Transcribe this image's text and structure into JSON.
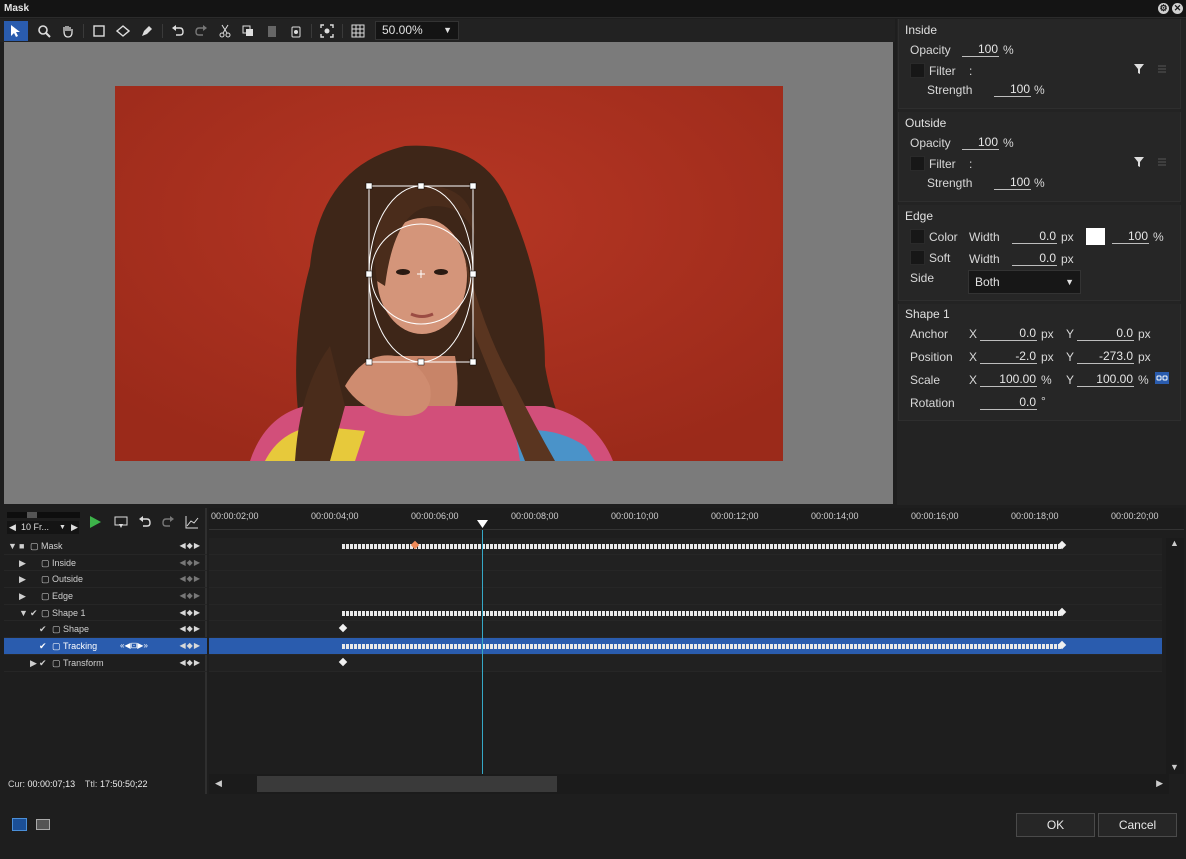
{
  "window": {
    "title": "Mask",
    "settings_icon": "gear-icon",
    "close_icon": "close-icon"
  },
  "toolbar": {
    "tools": [
      "select-arrow-icon",
      "zoom-icon",
      "hand-icon",
      "rectangle-icon",
      "ellipse-icon",
      "pen-icon",
      "undo-icon",
      "redo-icon",
      "cut-icon",
      "copy-icon",
      "paste-icon",
      "delete-icon",
      "fit-icon",
      "grid-icon"
    ],
    "zoom_value": "50.00%"
  },
  "inside": {
    "header": "Inside",
    "opacity_label": "Opacity",
    "opacity_value": "100",
    "opacity_unit": "%",
    "filter_label": "Filter",
    "filter_sep": ":",
    "strength_label": "Strength",
    "strength_value": "100",
    "strength_unit": "%"
  },
  "outside": {
    "header": "Outside",
    "opacity_label": "Opacity",
    "opacity_value": "100",
    "opacity_unit": "%",
    "filter_label": "Filter",
    "filter_sep": ":",
    "strength_label": "Strength",
    "strength_value": "100",
    "strength_unit": "%"
  },
  "edge": {
    "header": "Edge",
    "color_label": "Color",
    "width_label": "Width",
    "color_width_value": "0.0",
    "px": "px",
    "color_swatch": "#ffffff",
    "color_pct_value": "100",
    "pct": "%",
    "soft_label": "Soft",
    "soft_width_value": "0.0",
    "side_label": "Side",
    "side_value": "Both"
  },
  "shape1": {
    "header": "Shape 1",
    "anchor_label": "Anchor",
    "anchor_x": "0.0",
    "anchor_y": "0.0",
    "position_label": "Position",
    "position_x": "-2.0",
    "position_y": "-273.0",
    "scale_label": "Scale",
    "scale_x": "100.00",
    "scale_y": "100.00",
    "rotation_label": "Rotation",
    "rotation_value": "0.0",
    "degree": "°",
    "x": "X",
    "y": "Y",
    "px": "px",
    "pct": "%"
  },
  "timeline": {
    "frames_select": "10 Fr...",
    "ruler": [
      "00:00:02;00",
      "00:00:04;00",
      "00:00:06;00",
      "00:00:08;00",
      "00:00:10;00",
      "00:00:12;00",
      "00:00:14;00",
      "00:00:16;00",
      "00:00:18;00",
      "00:00:20;00"
    ],
    "tracks": [
      "Mask",
      "Inside",
      "Outside",
      "Edge",
      "Shape 1",
      "Shape",
      "Tracking",
      "Transform"
    ],
    "cur_label": "Cur:",
    "cur_value": "00:00:07;13",
    "ttl_label": "Ttl:",
    "ttl_value": "17:50:50;22"
  },
  "footer": {
    "ok": "OK",
    "cancel": "Cancel"
  },
  "colors": {
    "accent": "#2a5cae",
    "playhead": "#35a8c6",
    "video_bg": "#a9301f"
  }
}
